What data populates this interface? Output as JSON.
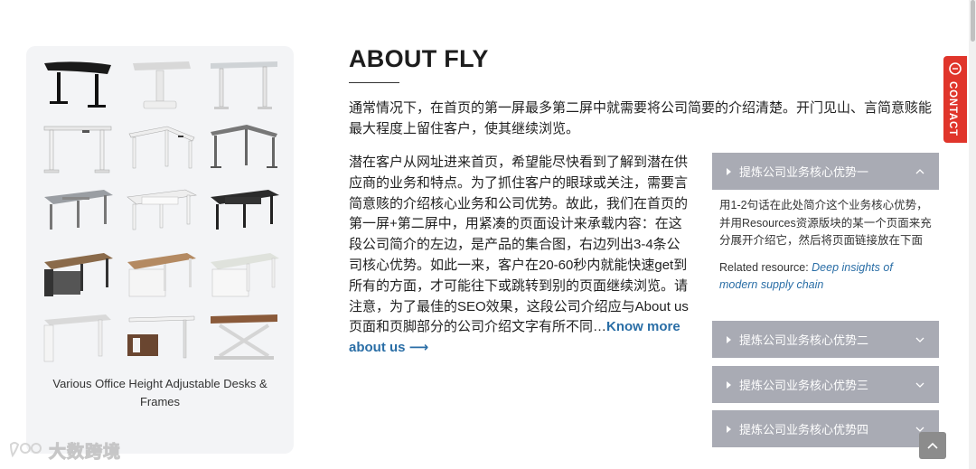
{
  "about": {
    "title": "ABOUT FLY",
    "intro": "通常情况下，在首页的第一屏最多第二屏中就需要将公司简要的介绍清楚。开门见山、言简意赅能最大程度上留住客户，使其继续浏览。",
    "body": "潜在客户从网址进来首页，希望能尽快看到了解到潜在供应商的业务和特点。为了抓住客户的眼球或关注，需要言简意赅的介绍核心业务和公司优势。故此，我们在首页的第一屏+第二屏中，用紧凑的页面设计来承载内容：在这段公司简介的左边，是产品的集合图，右边列出3-4条公司核心优势。如此一来，客户在20-60秒内就能快速get到所有的方面，才可能往下或跳转到别的页面继续浏览。请注意，为了最佳的SEO效果，这段公司介绍应与About us页面和页脚部分的公司介绍文字有所不同…",
    "know_more": "Know more about us",
    "know_more_arrow": "⟶"
  },
  "product_card": {
    "caption": "Various Office Height Adjustable Desks & Frames",
    "items": [
      "black-curved-desk",
      "white-single-column-desk",
      "white-standing-desk",
      "white-desk-frame",
      "white-l-shaped-frame",
      "grey-l-shaped-frame",
      "grey-double-desk",
      "white-double-desk",
      "black-double-desk",
      "walnut-bench-desk",
      "oak-bench-desk",
      "light-bench-desk",
      "white-waterfall-desk",
      "executive-desk-with-cabinet",
      "scissor-lift-desk"
    ]
  },
  "accordion": [
    {
      "label": "提炼公司业务核心优势一",
      "expanded": true,
      "text": "用1-2句话在此处简介这个业务核心优势，并用Resources资源版块的某一个页面来充分展开介绍它，然后将页面链接放在下面",
      "related_label": "Related resource:",
      "related_link": "Deep insights of modern supply chain"
    },
    {
      "label": "提炼公司业务核心优势二",
      "expanded": false
    },
    {
      "label": "提炼公司业务核心优势三",
      "expanded": false
    },
    {
      "label": "提炼公司业务核心优势四",
      "expanded": false
    }
  ],
  "contact_tab": {
    "label": "CONTACT"
  },
  "watermark": {
    "text": "大数跨境"
  },
  "colors": {
    "accordion_bg": "#a9abb4",
    "link": "#2a6ea6",
    "contact": "#e0352b",
    "card_bg": "#f3f4f6"
  },
  "icons": [
    "chat-bubble-icon",
    "chevron-up-icon",
    "chevron-down-icon",
    "arrow-up-icon",
    "arrow-right-icon",
    "caret-right-icon"
  ]
}
